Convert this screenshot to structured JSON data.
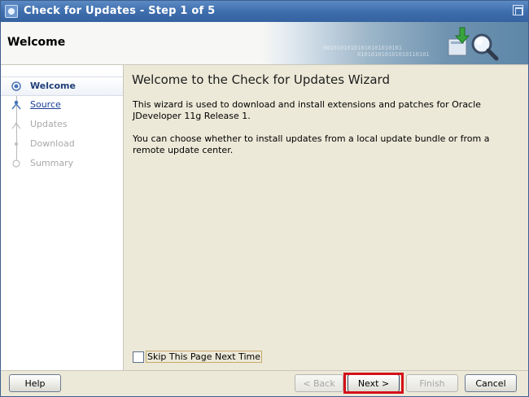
{
  "window": {
    "title": "Check for Updates - Step 1 of 5"
  },
  "banner": {
    "title": "Welcome",
    "binary_line1": "00101010101010101010101",
    "binary_line2": "010101010101010110101"
  },
  "nav": {
    "items": [
      {
        "label": "Welcome",
        "state": "current"
      },
      {
        "label": "Source",
        "state": "link"
      },
      {
        "label": "Updates",
        "state": "disabled"
      },
      {
        "label": "Download",
        "state": "disabled"
      },
      {
        "label": "Summary",
        "state": "disabled"
      }
    ]
  },
  "content": {
    "title": "Welcome to the Check for Updates Wizard",
    "paragraph1": "This wizard is used to download and install extensions and patches for Oracle JDeveloper 11g Release 1.",
    "paragraph2": "You can choose whether to install updates from a local update bundle or from a remote update center.",
    "skip_label": "Skip This Page Next Time",
    "skip_checked": false
  },
  "footer": {
    "help": "Help",
    "back": "< Back",
    "next": "Next >",
    "finish": "Finish",
    "cancel": "Cancel"
  },
  "colors": {
    "titlebar": "#3f6fae",
    "highlight": "#d4101a",
    "link": "#1a3e94"
  }
}
